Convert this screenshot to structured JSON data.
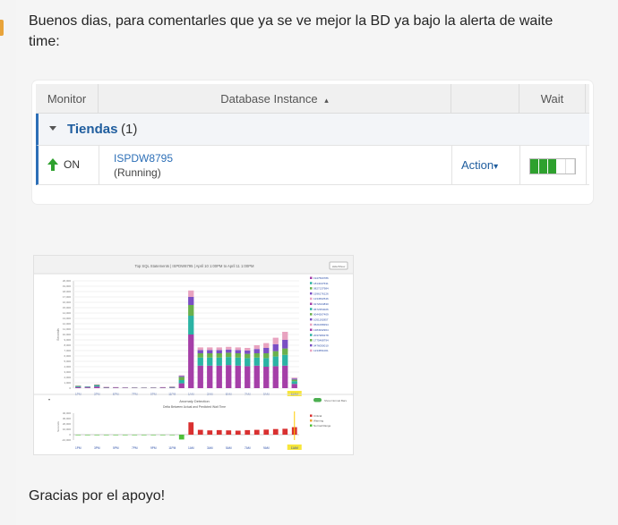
{
  "message": {
    "text_top": "Buenos dias, para comentarles que ya se ve mejor la BD ya bajo la alerta de waite time:",
    "text_bottom": "Gracias por el apoyo!"
  },
  "table": {
    "columns": {
      "monitor": "Monitor",
      "database_instance": "Database Instance",
      "sort_glyph": "▴",
      "wait": "Wait"
    },
    "group": {
      "label": "Tiendas",
      "count": "(1)"
    },
    "row": {
      "status": "ON",
      "instance": "ISPDW8795",
      "state": "(Running)",
      "action_label": "Action",
      "action_glyph": "▾",
      "wait_segments_on": 3,
      "wait_segments_total": 5
    },
    "colors": {
      "status_ok": "#2ea12e",
      "link": "#2d6fb7"
    }
  },
  "chart_data": [
    {
      "type": "bar",
      "title": "Top SQL Statements | ISPDW8795 | April 10 1:00PM to April 11 1:00PM",
      "ylabel": "Seconds",
      "ylim": [
        0,
        20000
      ],
      "yticks": [
        0,
        1000,
        2000,
        3000,
        4000,
        5000,
        6000,
        7000,
        8000,
        9000,
        10000,
        11000,
        12000,
        13000,
        14000,
        15000,
        16000,
        17000,
        18000,
        19000,
        20000
      ],
      "categories": [
        "1PM",
        "2PM",
        "3PM",
        "4PM",
        "5PM",
        "6PM",
        "7PM",
        "8PM",
        "9PM",
        "10PM",
        "11PM",
        "12AM",
        "1AM",
        "2AM",
        "3AM",
        "4AM",
        "5AM",
        "6AM",
        "7AM",
        "8AM",
        "9AM",
        "10AM",
        "11AM",
        "12AM"
      ],
      "xtick_labels": [
        "1PM",
        "3PM",
        "5PM",
        "7PM",
        "9PM",
        "11PM",
        "1AM",
        "3AM",
        "5AM",
        "7AM",
        "9AM",
        "11AM"
      ],
      "highlighted_label": "11AM",
      "series": [
        {
          "color": "#a53fa8",
          "values": [
            200,
            150,
            300,
            100,
            80,
            70,
            60,
            50,
            60,
            80,
            100,
            900,
            10000,
            4200,
            4200,
            4200,
            4300,
            4200,
            4100,
            4200,
            4000,
            4100,
            4200,
            800
          ]
        },
        {
          "color": "#2bb3a4",
          "values": [
            150,
            100,
            200,
            60,
            50,
            40,
            40,
            30,
            40,
            50,
            80,
            600,
            3500,
            1500,
            1500,
            1500,
            1500,
            1500,
            1500,
            1500,
            1600,
            1800,
            2000,
            500
          ]
        },
        {
          "color": "#6ab04c",
          "values": [
            80,
            50,
            100,
            30,
            30,
            20,
            20,
            20,
            20,
            30,
            60,
            600,
            2000,
            800,
            800,
            800,
            800,
            800,
            800,
            800,
            900,
            1000,
            1200,
            300
          ]
        },
        {
          "color": "#7a4fc4",
          "values": [
            40,
            30,
            60,
            20,
            20,
            10,
            10,
            10,
            10,
            20,
            30,
            200,
            1500,
            600,
            600,
            600,
            600,
            600,
            600,
            800,
            1000,
            1300,
            1600,
            200
          ]
        },
        {
          "color": "#e8a3c0",
          "values": [
            30,
            20,
            40,
            10,
            10,
            10,
            10,
            10,
            10,
            10,
            20,
            100,
            1200,
            500,
            500,
            500,
            500,
            500,
            500,
            700,
            900,
            1200,
            1500,
            150
          ]
        }
      ],
      "legend_entries": [
        "1947500786",
        "1814047631",
        "0827137984",
        "1596176126",
        "1234562546",
        "0172024830",
        "0672354026",
        "0044267409",
        "1051192857",
        "0521068294",
        "1384932964",
        "2037380278",
        "1775468794",
        "0476050010",
        "1234551001"
      ],
      "button_label": "Hide/Show"
    },
    {
      "type": "bar",
      "title": "Anomaly Detection",
      "subtitle": "Delta Between Actual and Predicted Wait Time",
      "ylabel": "Seconds",
      "ylim": [
        -10000,
        40000
      ],
      "yticks": [
        40000,
        30000,
        20000,
        10000,
        0,
        -10000
      ],
      "toggle_label": "Show Normal Bars",
      "categories": [
        "1PM",
        "2PM",
        "3PM",
        "4PM",
        "5PM",
        "6PM",
        "7PM",
        "8PM",
        "9PM",
        "10PM",
        "11PM",
        "12AM",
        "1AM",
        "2AM",
        "3AM",
        "4AM",
        "5AM",
        "6AM",
        "7AM",
        "8AM",
        "9AM",
        "10AM",
        "11AM",
        "12AM"
      ],
      "values": [
        -800,
        -600,
        -500,
        -400,
        -300,
        -300,
        -200,
        -200,
        -200,
        -300,
        -400,
        -9000,
        23000,
        9000,
        8000,
        8500,
        8000,
        7500,
        8500,
        9000,
        9500,
        10500,
        11000,
        14000
      ],
      "series_colors": {
        "positive": "#d93030",
        "negative": "#4fbf3a",
        "normal": "#ffcc00"
      },
      "legend_entries": [
        "Critical",
        "Warning",
        "Normal Range"
      ]
    }
  ]
}
